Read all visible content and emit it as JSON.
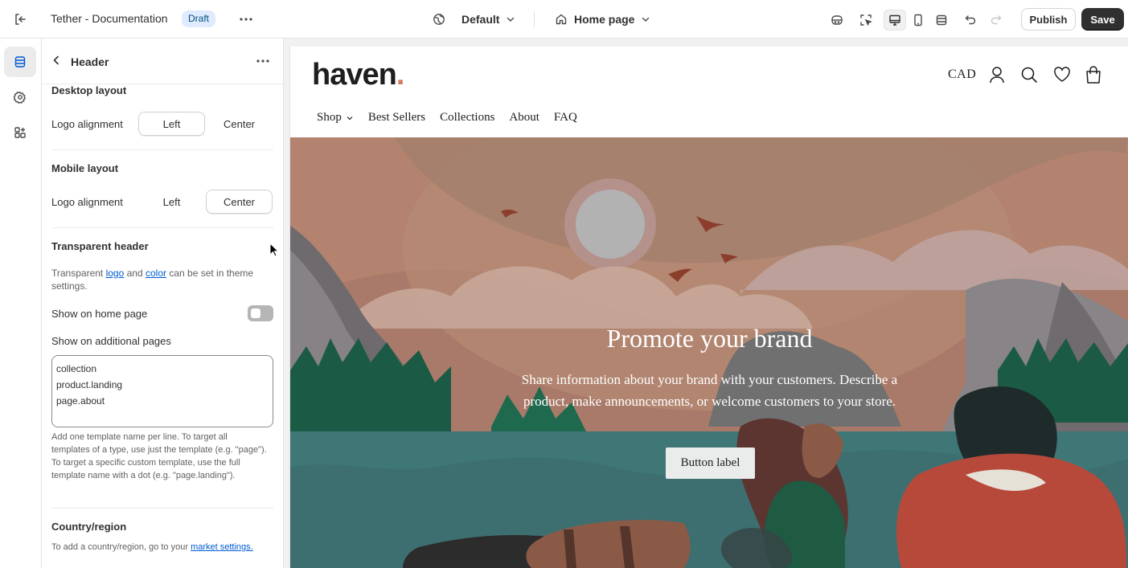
{
  "topbar": {
    "store_title": "Tether - Documentation",
    "status_badge": "Draft",
    "theme_selector": "Default",
    "page_selector": "Home page",
    "publish_label": "Publish",
    "save_label": "Save"
  },
  "panel": {
    "title": "Header",
    "desktop_layout": {
      "title": "Desktop layout",
      "label": "Logo alignment",
      "options": [
        "Left",
        "Center"
      ],
      "selected": "Left"
    },
    "mobile_layout": {
      "title": "Mobile layout",
      "label": "Logo alignment",
      "options": [
        "Left",
        "Center"
      ],
      "selected": "Center"
    },
    "transparent_header": {
      "title": "Transparent header",
      "desc_prefix": "Transparent ",
      "desc_link1": "logo",
      "desc_mid": " and ",
      "desc_link2": "color",
      "desc_suffix": " can be set in theme settings.",
      "show_home_label": "Show on home page",
      "show_home_enabled": false,
      "additional_label": "Show on additional pages",
      "additional_lines": [
        "collection",
        "product.landing",
        "page.about"
      ],
      "help": "Add one template name per line. To target all templates of a type, use just the template (e.g. \"page\"). To target a specific custom template, use the full template name with a dot (e.g. \"page.landing\")."
    },
    "country_region": {
      "title": "Country/region",
      "desc_prefix": "To add a country/region, go to your ",
      "desc_link": "market settings."
    }
  },
  "preview": {
    "logo_text": "haven",
    "logo_dot": ".",
    "currency": "CAD",
    "nav": [
      "Shop",
      "Best Sellers",
      "Collections",
      "About",
      "FAQ"
    ],
    "hero_title": "Promote your brand",
    "hero_text": "Share information about your brand with your customers. Describe a product, make announcements, or welcome customers to your store.",
    "hero_button": "Button label"
  },
  "colors": {
    "accent_dark": "#303030",
    "badge_bg": "#e0ebff",
    "link": "#005bd3",
    "logo_dot": "#d27b5e"
  }
}
